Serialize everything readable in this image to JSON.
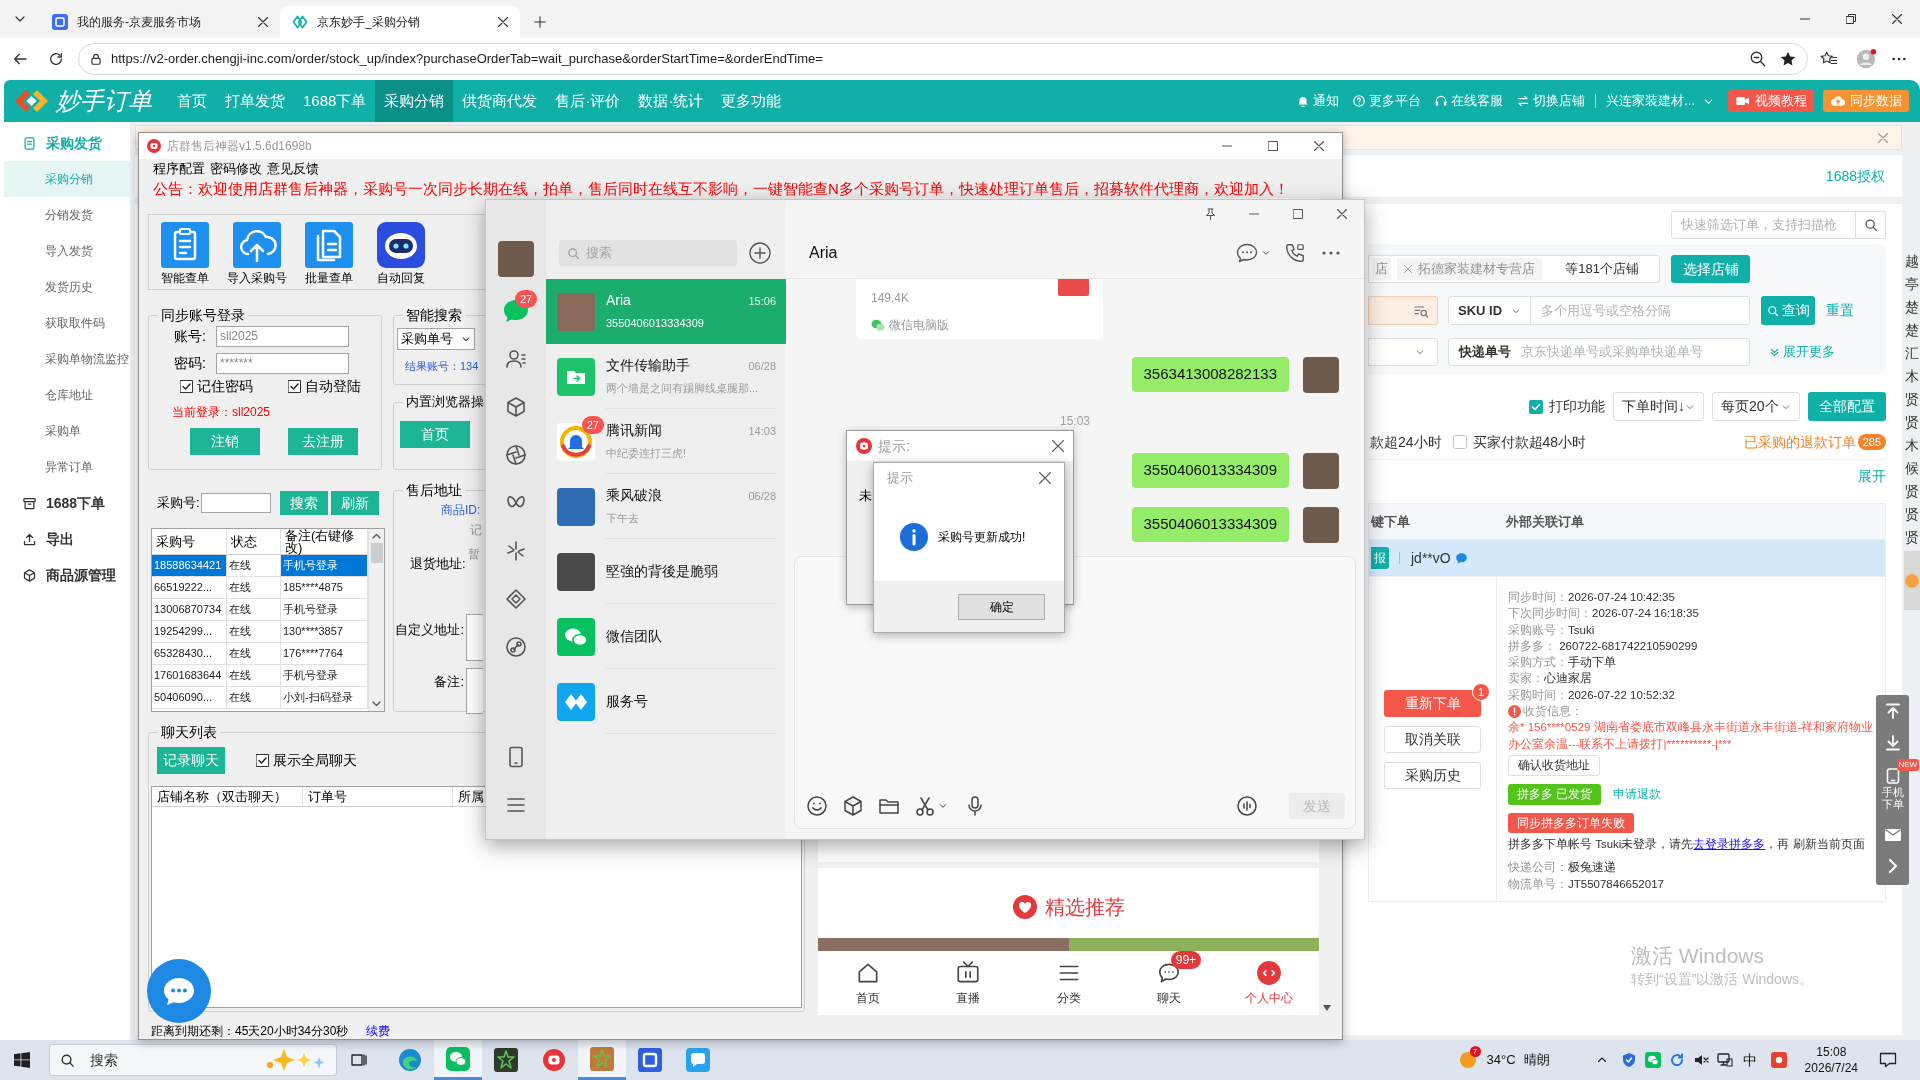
{
  "browser": {
    "tabs": [
      {
        "title": "我的服务-京麦服务市场",
        "selected": false
      },
      {
        "title": "京东妙手_采购分销",
        "selected": true
      }
    ],
    "url": "https://v2-order.chengji-inc.com/order/stock_up/index?purchaseOrderTab=wait_purchase&orderStartTime=&orderEndTime="
  },
  "app": {
    "logo": "妙手订单",
    "nav": [
      {
        "label": "首页",
        "selected": false
      },
      {
        "label": "打单发货",
        "selected": false
      },
      {
        "label": "1688下单",
        "selected": false
      },
      {
        "label": "采购分销",
        "selected": true
      },
      {
        "label": "供货商代发",
        "selected": false
      },
      {
        "label": "售后·评价",
        "selected": false
      },
      {
        "label": "数据·统计",
        "selected": false
      },
      {
        "label": "更多功能",
        "selected": false
      }
    ],
    "header_links": [
      "通知",
      "更多平台",
      "在线客服",
      "切换店铺"
    ],
    "store": "兴连家装建材...",
    "buttons": [
      "视频教程",
      "同步数据"
    ]
  },
  "sidebar": {
    "groups": [
      {
        "label": "采购发货",
        "active": true,
        "children": [
          {
            "label": "采购分销",
            "selected": true
          },
          {
            "label": "分销发货",
            "selected": false
          },
          {
            "label": "导入发货",
            "selected": false
          },
          {
            "label": "发货历史",
            "selected": false
          },
          {
            "label": "获取取件码",
            "selected": false
          },
          {
            "label": "采购单物流监控",
            "selected": false
          },
          {
            "label": "仓库地址",
            "selected": false
          },
          {
            "label": "采购单",
            "selected": false
          },
          {
            "label": "异常订单",
            "selected": false
          }
        ]
      },
      {
        "label": "1688下单",
        "active": false
      },
      {
        "label": "导出",
        "active": false
      },
      {
        "label": "商品源管理",
        "active": false
      }
    ]
  },
  "page": {
    "auth_link": "1688授权",
    "search": {
      "placeholder": "快速筛选订单，支持扫描枪"
    },
    "filters": {
      "shop_tag_fragment": "店",
      "shop_tag": "拓德家装建材专营店",
      "shop_count": "等181个店铺",
      "select_shop_button": "选择店铺",
      "sku": {
        "select": "SKU ID",
        "placeholder": "多个用逗号或空格分隔"
      },
      "query_button": "查询",
      "reset_link": "重置",
      "tracking": {
        "label": "快递单号",
        "placeholder": "京东快递单号或采购单快递单号"
      },
      "expand_more": "展开更多"
    },
    "toolbar": {
      "print": {
        "label": "打印功能",
        "checked": true
      },
      "sort": "下单时间↓",
      "page_size": "每页20个",
      "config_button": "全部配置"
    },
    "quick_filter_fragment": "款超24小时",
    "quick_filter": {
      "label": "买家付款超48小时",
      "checked": false
    },
    "refund_orders": {
      "label": "已采购的退款订单",
      "count": "285"
    },
    "expand_link": "展开",
    "table": {
      "columns": [
        "键下单",
        "外部关联订单"
      ],
      "order": {
        "selected": true,
        "tag": "报",
        "buyer": "jd**vO",
        "actions": [
          {
            "label": "重新下单",
            "kind": "primary",
            "badge": "1"
          },
          {
            "label": "取消关联",
            "kind": "default"
          },
          {
            "label": "采购历史",
            "kind": "default"
          }
        ],
        "details": [
          {
            "label": "同步时间：",
            "value": "2026-07-24 10:42:35"
          },
          {
            "label": "下次同步时间：",
            "value": "2026-07-24 16:18:35"
          },
          {
            "label": "采购账号：",
            "value": "Tsuki"
          },
          {
            "label": "拼多多：",
            "value": " 260722-681742210590299"
          },
          {
            "label": "采购方式：",
            "value": "手动下单"
          },
          {
            "label": "卖家：",
            "value": "心迪家居"
          },
          {
            "label": "采购时间：",
            "value": "2026-07-22 10:52:32"
          }
        ],
        "shipping": {
          "label": "收货信息：",
          "address": "余* 156****0529 湖南省娄底市双峰县永丰街道永丰街道-祥和家府物业办公室余温---联系不上请拨打|**********-|***"
        },
        "confirm_button": "确认收货地址",
        "status_tag": "拼多多 已发货",
        "refund_link": "申请退款",
        "error_tag": "同步拼多多订单失败",
        "login_notice": {
          "before": "拼多多下单帐号 Tsuki未登录，请先",
          "link": "去登录拼多多",
          "after": "，再 刷新当前页面"
        },
        "logistics": [
          {
            "label": "快递公司：",
            "value": "极兔速递"
          },
          {
            "label": "物流单号：",
            "value": "JT5507846652017"
          }
        ]
      }
    }
  },
  "side_strip": [
    "越",
    "亭",
    "楚",
    "楚",
    "汇",
    "木",
    "贤",
    "贤",
    "木",
    "候",
    "贤",
    "贤",
    "贤"
  ],
  "float_toolbar": {
    "phone_label": "手机下单",
    "new_badge": "NEW"
  },
  "activation": {
    "title": "激活 Windows",
    "hint": "转到“设置”以激活 Windows。"
  },
  "tool_window": {
    "title": "店群售后神器v1.5.6d1698b",
    "menu": [
      "程序配置",
      "密码修改",
      "意见反馈"
    ],
    "notice": "公告：欢迎使用店群售后神器，采购号一次同步长期在线，拍单，售后同时在线互不影响，一键智能查N多个采购号订单，快速处理订单售后，招募软件代理商，欢迎加入！",
    "tools": [
      {
        "label": "智能查单"
      },
      {
        "label": "导入采购号"
      },
      {
        "label": "批量查单"
      },
      {
        "label": "自动回复"
      }
    ],
    "login": {
      "title": "同步账号登录",
      "account_label": "账号:",
      "account": "sll2025",
      "password_label": "密码:",
      "password": "*******",
      "remember": {
        "label": "记住密码",
        "checked": true
      },
      "auto_login": {
        "label": "自动登陆",
        "checked": true
      },
      "current": "当前登录：sll2025",
      "buttons": [
        "注销",
        "去注册"
      ]
    },
    "smart_search": {
      "title": "智能搜索",
      "select": "采购单号",
      "result": "结果账号：134"
    },
    "browser_ops": {
      "title": "内置浏览器操",
      "home_button": "首页"
    },
    "account_search": {
      "label": "采购号:",
      "buttons": [
        "搜索",
        "刷新"
      ]
    },
    "accounts": {
      "columns": [
        "采购号",
        "状态",
        "备注(右键修改)"
      ],
      "rows": [
        {
          "cells": [
            "18588634421",
            "在线",
            "手机号登录"
          ],
          "selected": true
        },
        {
          "cells": [
            "66519222...",
            "在线",
            "185****4875"
          ],
          "selected": false
        },
        {
          "cells": [
            "13006870734",
            "在线",
            "手机号登录"
          ],
          "selected": false
        },
        {
          "cells": [
            "19254299...",
            "在线",
            "130****3857"
          ],
          "selected": false
        },
        {
          "cells": [
            "65328430...",
            "在线",
            "176****7764"
          ],
          "selected": false
        },
        {
          "cells": [
            "17601683644",
            "在线",
            "手机号登录"
          ],
          "selected": false
        },
        {
          "cells": [
            "50406090...",
            "在线",
            "小刘-扫码登录"
          ],
          "selected": false
        }
      ]
    },
    "after_sale": {
      "title": "售后地址",
      "product_id_label": "商品ID:",
      "fragments": [
        "记",
        "暂"
      ],
      "return_label": "退货地址:",
      "custom_label": "自定义地址:",
      "note_label": "备注:"
    },
    "chat_list": {
      "title": "聊天列表",
      "record_button": "记录聊天",
      "show_all": {
        "label": "展示全局聊天",
        "checked": true
      },
      "columns": [
        "店铺名称（双击聊天）",
        "订单号",
        "所属"
      ]
    },
    "webview": {
      "section_title": "精选推荐",
      "tabs": [
        {
          "label": "首页",
          "selected": false
        },
        {
          "label": "直播",
          "selected": false
        },
        {
          "label": "分类",
          "selected": false
        },
        {
          "label": "聊天",
          "selected": false,
          "badge": "99+"
        },
        {
          "label": "个人中心",
          "selected": true
        }
      ]
    },
    "expiry": {
      "text": "距离到期还剩：45天20小时34分30秒",
      "link": "续费"
    }
  },
  "wechat": {
    "search_placeholder": "搜索",
    "nav_badge": "27",
    "chats": [
      {
        "name": "Aria",
        "time": "15:06",
        "preview": "3550406013334309",
        "selected": true
      },
      {
        "name": "文件传输助手",
        "time": "06/28",
        "preview": "两个墙是之间有踢脚线桌腿那...",
        "selected": false
      },
      {
        "name": "腾讯新闻",
        "time": "14:03",
        "preview": "中纪委连打三虎!",
        "badge": "27",
        "selected": false
      },
      {
        "name": "乘风破浪",
        "time": "06/28",
        "preview": "下午去",
        "selected": false
      },
      {
        "name": "堅強的背後是脆弱",
        "selected": false
      },
      {
        "name": "微信团队",
        "selected": false
      },
      {
        "name": "服务号",
        "selected": false
      }
    ],
    "contact": "Aria",
    "messages": [
      {
        "kind": "file",
        "size": "149.4K",
        "source": "微信电脑版"
      },
      {
        "kind": "text",
        "text": "3563413008282133"
      },
      {
        "kind": "time",
        "text": "15:03"
      },
      {
        "kind": "text",
        "text": "3550406013334309"
      },
      {
        "kind": "text",
        "text": "3550406013334309"
      }
    ],
    "send_button": {
      "label": "发送",
      "disabled": true
    }
  },
  "dialogs": [
    {
      "title": "提示:",
      "fragment": "未"
    },
    {
      "title": "提示",
      "message": "采购号更新成功!",
      "button": "确定"
    }
  ],
  "taskbar": {
    "search_placeholder": "搜索",
    "apps": [
      {
        "active": false
      },
      {
        "active": true
      },
      {
        "active": false
      },
      {
        "active": false
      },
      {
        "active": true
      },
      {
        "active": false
      },
      {
        "active": false
      }
    ],
    "weather": {
      "badge": "7",
      "temp": "34°C",
      "condition": "晴朗"
    },
    "ime": "中",
    "time": "15:08",
    "date": "2026/7/24"
  }
}
